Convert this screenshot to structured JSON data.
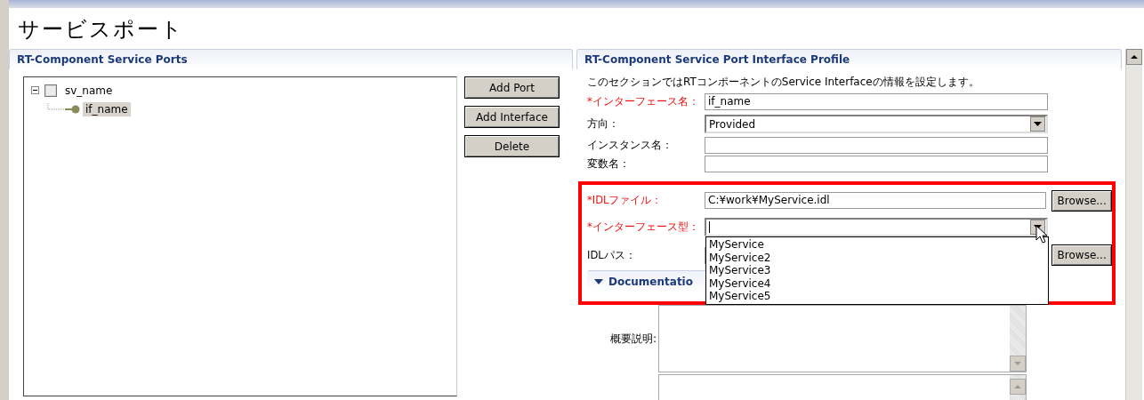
{
  "page_title": "サービスポート",
  "ports_section": {
    "title": "RT-Component Service Ports",
    "tree": [
      {
        "label": "sv_name",
        "expanded": true,
        "selected": false,
        "children": [
          {
            "label": "if_name",
            "selected": true
          }
        ]
      }
    ],
    "buttons": [
      "Add Port",
      "Add Interface",
      "Delete"
    ]
  },
  "profile_section": {
    "title": "RT-Component Service Port Interface Profile",
    "description": "このセクションではRTコンポーネントのService Interfaceの情報を設定します。",
    "fields": [
      {
        "kind": "text",
        "label": "*インターフェース名：",
        "required": true,
        "value": "if_name"
      },
      {
        "kind": "select",
        "label": "方向：",
        "required": false,
        "value": "Provided",
        "open": false
      },
      {
        "kind": "text",
        "label": "インスタンス名：",
        "required": false
      },
      {
        "kind": "text",
        "label": "変数名：",
        "required": false
      },
      {
        "kind": "text",
        "label": "*IDLファイル：",
        "required": true,
        "value": "C:¥work¥MyService.idl",
        "browse": "Browse...",
        "highlighted": true
      },
      {
        "kind": "select",
        "label": "*インターフェース型：",
        "required": true,
        "open": true,
        "options": [
          "MyService",
          "MyService2",
          "MyService3",
          "MyService4",
          "MyService5"
        ],
        "highlighted": true
      },
      {
        "kind": "text",
        "label": "IDLパス：",
        "required": false,
        "browse": "Browse...",
        "highlighted": true
      }
    ],
    "documentation": {
      "title": "Documentatio",
      "expanded": true,
      "overview_label": "概要説明:"
    }
  }
}
